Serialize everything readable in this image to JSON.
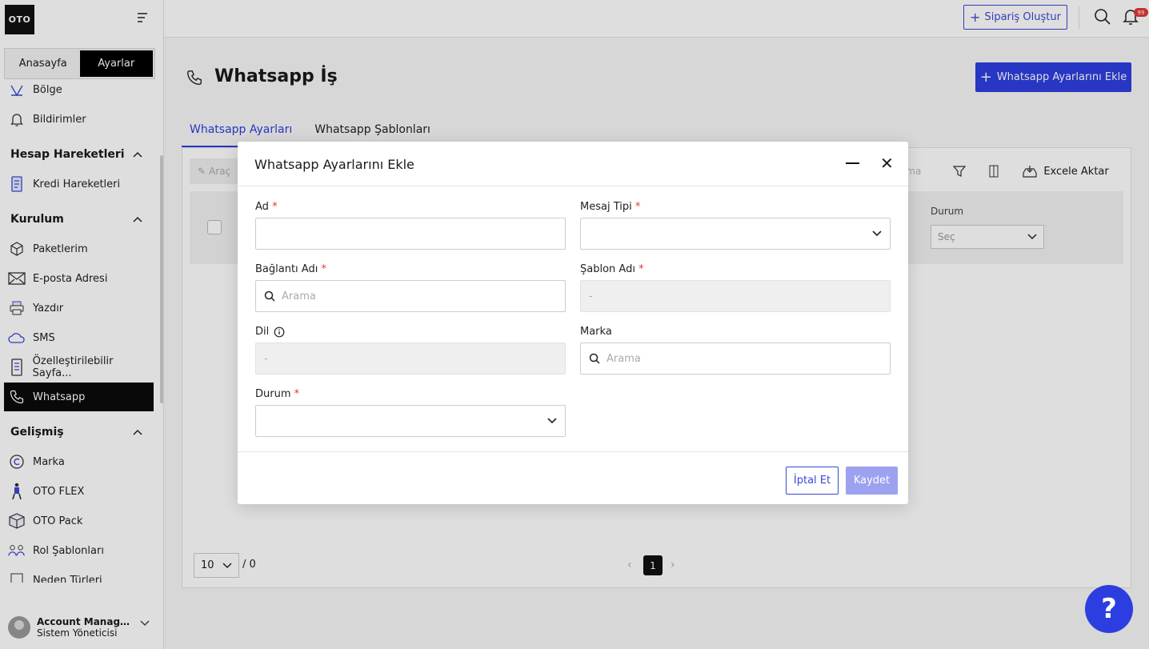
{
  "app": {
    "logo": "OTO"
  },
  "sidebar": {
    "tabs": [
      {
        "label": "Anasayfa"
      },
      {
        "label": "Ayarlar"
      }
    ],
    "items_top": [
      {
        "label": "Bölge"
      },
      {
        "label": "Bildirimler"
      }
    ],
    "groups": [
      {
        "label": "Hesap Hareketleri",
        "items": [
          {
            "label": "Kredi Hareketleri"
          }
        ]
      },
      {
        "label": "Kurulum",
        "items": [
          {
            "label": "Paketlerim"
          },
          {
            "label": "E-posta Adresi"
          },
          {
            "label": "Yazdır"
          },
          {
            "label": "SMS"
          },
          {
            "label": "Özelleştirilebilir Sayfa..."
          },
          {
            "label": "Whatsapp"
          }
        ]
      },
      {
        "label": "Gelişmiş",
        "items": [
          {
            "label": "Marka"
          },
          {
            "label": "OTO FLEX"
          },
          {
            "label": "OTO Pack"
          },
          {
            "label": "Rol Şablonları"
          },
          {
            "label": "Neden Türleri"
          }
        ]
      }
    ],
    "account": {
      "name": "Account Manage...",
      "role": "Sistem Yöneticisi"
    }
  },
  "topbar": {
    "order_button": "Sipariş Oluştur",
    "notification_count": "99"
  },
  "page": {
    "title": "Whatsapp İş",
    "add_button": "Whatsapp Ayarlarını Ekle",
    "tabs": [
      {
        "label": "Whatsapp Ayarları"
      },
      {
        "label": "Whatsapp Şablonları"
      }
    ],
    "toolbar": {
      "tools_label": "Araç",
      "search_tail": "rama",
      "export_label": "Excele Aktar"
    },
    "table": {
      "durum_label": "Durum",
      "durum_placeholder": "Seç"
    },
    "pagination": {
      "page_size": "10",
      "total": "/ 0",
      "current": "1"
    }
  },
  "modal": {
    "title": "Whatsapp Ayarlarını Ekle",
    "fields": {
      "ad": {
        "label": "Ad",
        "value": ""
      },
      "mesaj_tipi": {
        "label": "Mesaj Tipi",
        "value": ""
      },
      "baglanti_adi": {
        "label": "Bağlantı Adı",
        "placeholder": "Arama"
      },
      "sablon_adi": {
        "label": "Şablon Adı",
        "value": "-"
      },
      "dil": {
        "label": "Dil",
        "value": "-"
      },
      "marka": {
        "label": "Marka",
        "placeholder": "Arama"
      },
      "durum": {
        "label": "Durum",
        "value": ""
      }
    },
    "required_mark": "*",
    "cancel": "İptal Et",
    "save": "Kaydet"
  },
  "help": {
    "label": "?"
  },
  "colors": {
    "accent": "#2d3ee0",
    "danger": "#e23838"
  }
}
